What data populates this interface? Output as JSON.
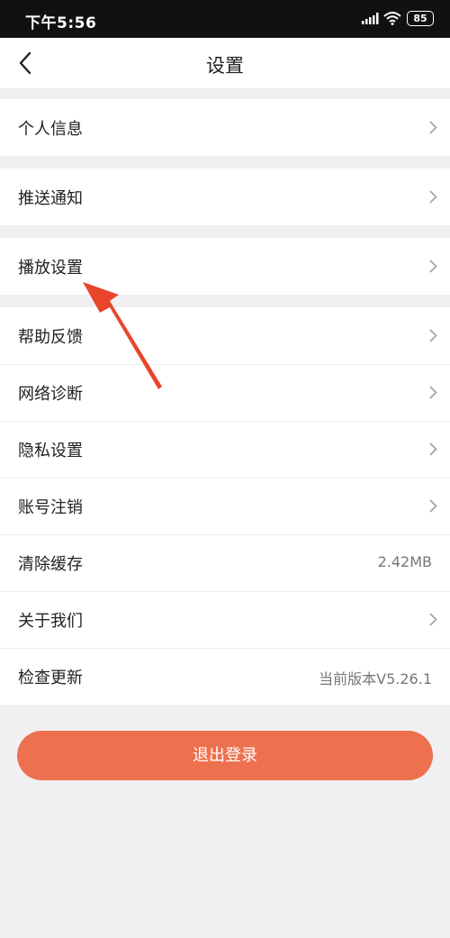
{
  "status_bar": {
    "time": "下午5:56",
    "battery": "85",
    "icons": [
      "signal-icon",
      "wifi-icon",
      "battery-icon"
    ]
  },
  "nav": {
    "title": "设置",
    "back_icon": "chevron-left-icon"
  },
  "settings": {
    "personal_info": "个人信息",
    "push_notifications": "推送通知",
    "playback_settings": "播放设置",
    "help_feedback": "帮助反馈",
    "network_diagnosis": "网络诊断",
    "privacy_settings": "隐私设置",
    "account_cancellation": "账号注销",
    "clear_cache": "清除缓存",
    "cache_size": "2.42MB",
    "about_us": "关于我们",
    "check_update": "检查更新",
    "current_version": "当前版本V5.26.1"
  },
  "logout": {
    "label": "退出登录"
  },
  "colors": {
    "accent": "#ee714f",
    "annotation_arrow": "#e8452c",
    "background": "#f0f0f2",
    "status_bar": "#111111"
  }
}
